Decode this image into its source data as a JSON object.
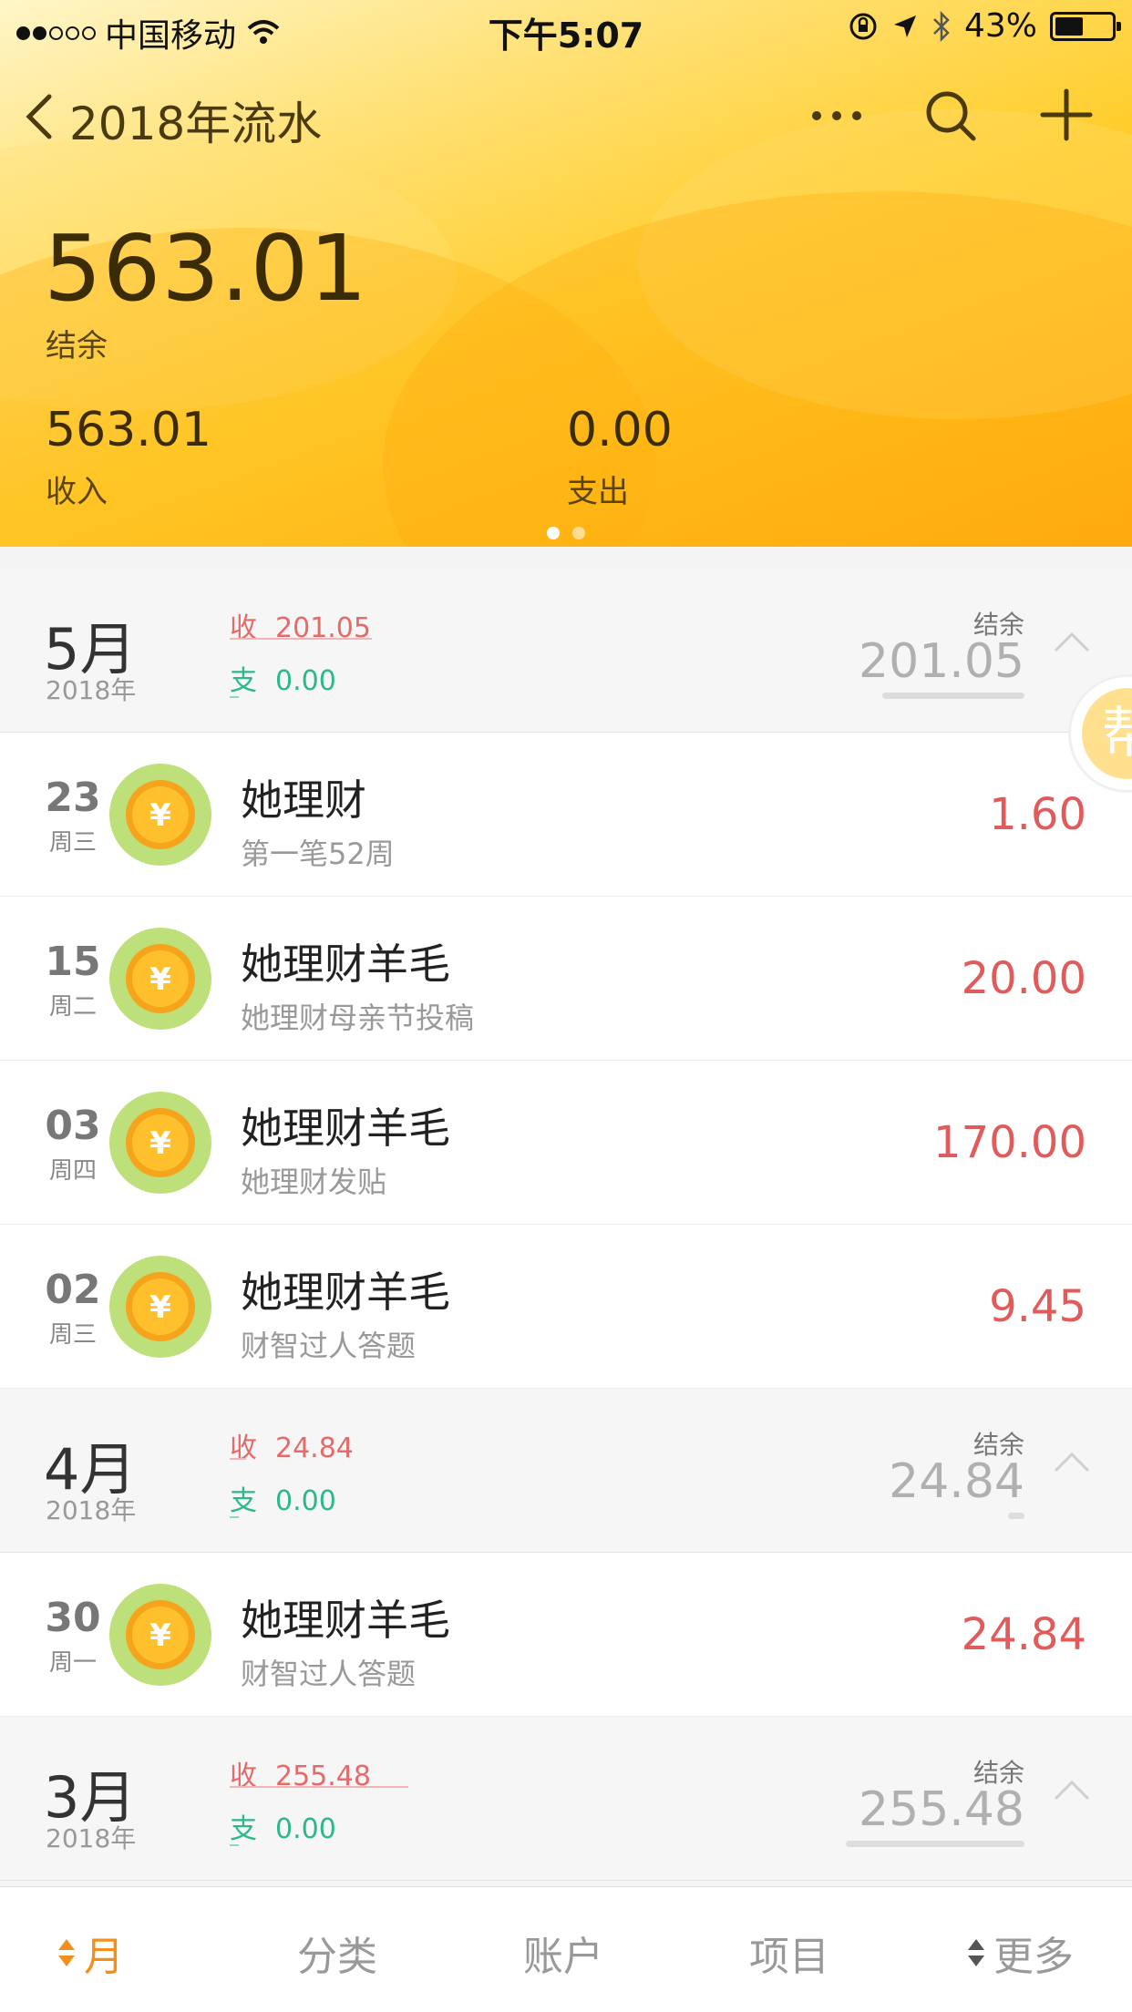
{
  "status": {
    "carrier": "中国移动",
    "time": "下午5:07",
    "battery": "43%"
  },
  "nav": {
    "title": "2018年流水"
  },
  "summary": {
    "balance": "563.01",
    "balance_label": "结余",
    "income": "563.01",
    "income_label": "收入",
    "expense": "0.00",
    "expense_label": "支出"
  },
  "labels": {
    "in": "收",
    "out": "支",
    "bal": "结余"
  },
  "months": [
    {
      "name": "5月",
      "year": "2018年",
      "income": "201.05",
      "expense": "0.00",
      "balance": "201.05",
      "transactions": [
        {
          "day": "23",
          "weekday": "周三",
          "title": "她理财",
          "note": "第一笔52周",
          "amount": "1.60"
        },
        {
          "day": "15",
          "weekday": "周二",
          "title": "她理财羊毛",
          "note": "她理财母亲节投稿",
          "amount": "20.00"
        },
        {
          "day": "03",
          "weekday": "周四",
          "title": "她理财羊毛",
          "note": "她理财发贴",
          "amount": "170.00"
        },
        {
          "day": "02",
          "weekday": "周三",
          "title": "她理财羊毛",
          "note": "财智过人答题",
          "amount": "9.45"
        }
      ]
    },
    {
      "name": "4月",
      "year": "2018年",
      "income": "24.84",
      "expense": "0.00",
      "balance": "24.84",
      "transactions": [
        {
          "day": "30",
          "weekday": "周一",
          "title": "她理财羊毛",
          "note": "财智过人答题",
          "amount": "24.84"
        }
      ]
    },
    {
      "name": "3月",
      "year": "2018年",
      "income": "255.48",
      "expense": "0.00",
      "balance": "255.48",
      "transactions": []
    }
  ],
  "float_badge": {
    "text": "帮"
  },
  "tabs": [
    {
      "label": "月",
      "active": true
    },
    {
      "label": "分类",
      "active": false
    },
    {
      "label": "账户",
      "active": false
    },
    {
      "label": "项目",
      "active": false
    },
    {
      "label": "更多",
      "active": false
    }
  ],
  "colors": {
    "accent": "#f2901e",
    "income": "#e66a6a",
    "expense": "#2db78a",
    "header": "#ffce2e"
  }
}
